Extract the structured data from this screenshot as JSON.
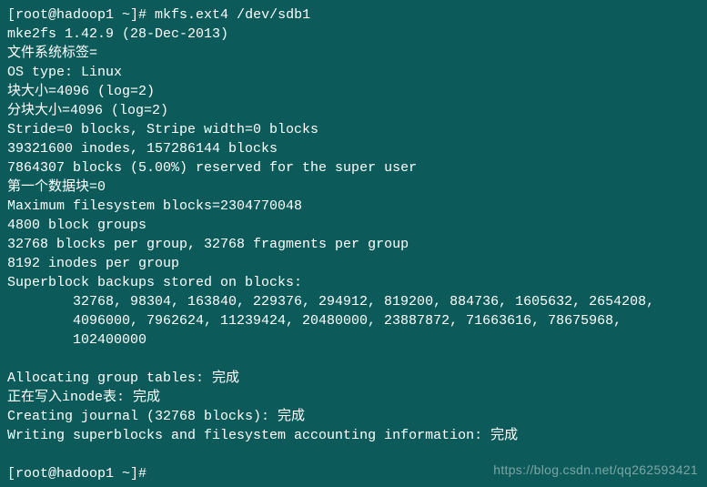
{
  "prompt1": {
    "user_host": "[root@hadoop1 ~]#",
    "command": "mkfs.ext4 /dev/sdb1"
  },
  "output": {
    "line1": "mke2fs 1.42.9 (28-Dec-2013)",
    "line2": "文件系统标签=",
    "line3": "OS type: Linux",
    "line4": "块大小=4096 (log=2)",
    "line5": "分块大小=4096 (log=2)",
    "line6": "Stride=0 blocks, Stripe width=0 blocks",
    "line7": "39321600 inodes, 157286144 blocks",
    "line8": "7864307 blocks (5.00%) reserved for the super user",
    "line9": "第一个数据块=0",
    "line10": "Maximum filesystem blocks=2304770048",
    "line11": "4800 block groups",
    "line12": "32768 blocks per group, 32768 fragments per group",
    "line13": "8192 inodes per group",
    "line14": "Superblock backups stored on blocks:",
    "line15": "32768, 98304, 163840, 229376, 294912, 819200, 884736, 1605632, 2654208,",
    "line16": "4096000, 7962624, 11239424, 20480000, 23887872, 71663616, 78675968,",
    "line17": "102400000",
    "line18": "Allocating group tables: 完成",
    "line19": "正在写入inode表: 完成",
    "line20": "Creating journal (32768 blocks): 完成",
    "line21": "Writing superblocks and filesystem accounting information: 完成"
  },
  "prompt2": {
    "user_host": "[root@hadoop1 ~]#"
  },
  "watermark": "https://blog.csdn.net/qq262593421"
}
